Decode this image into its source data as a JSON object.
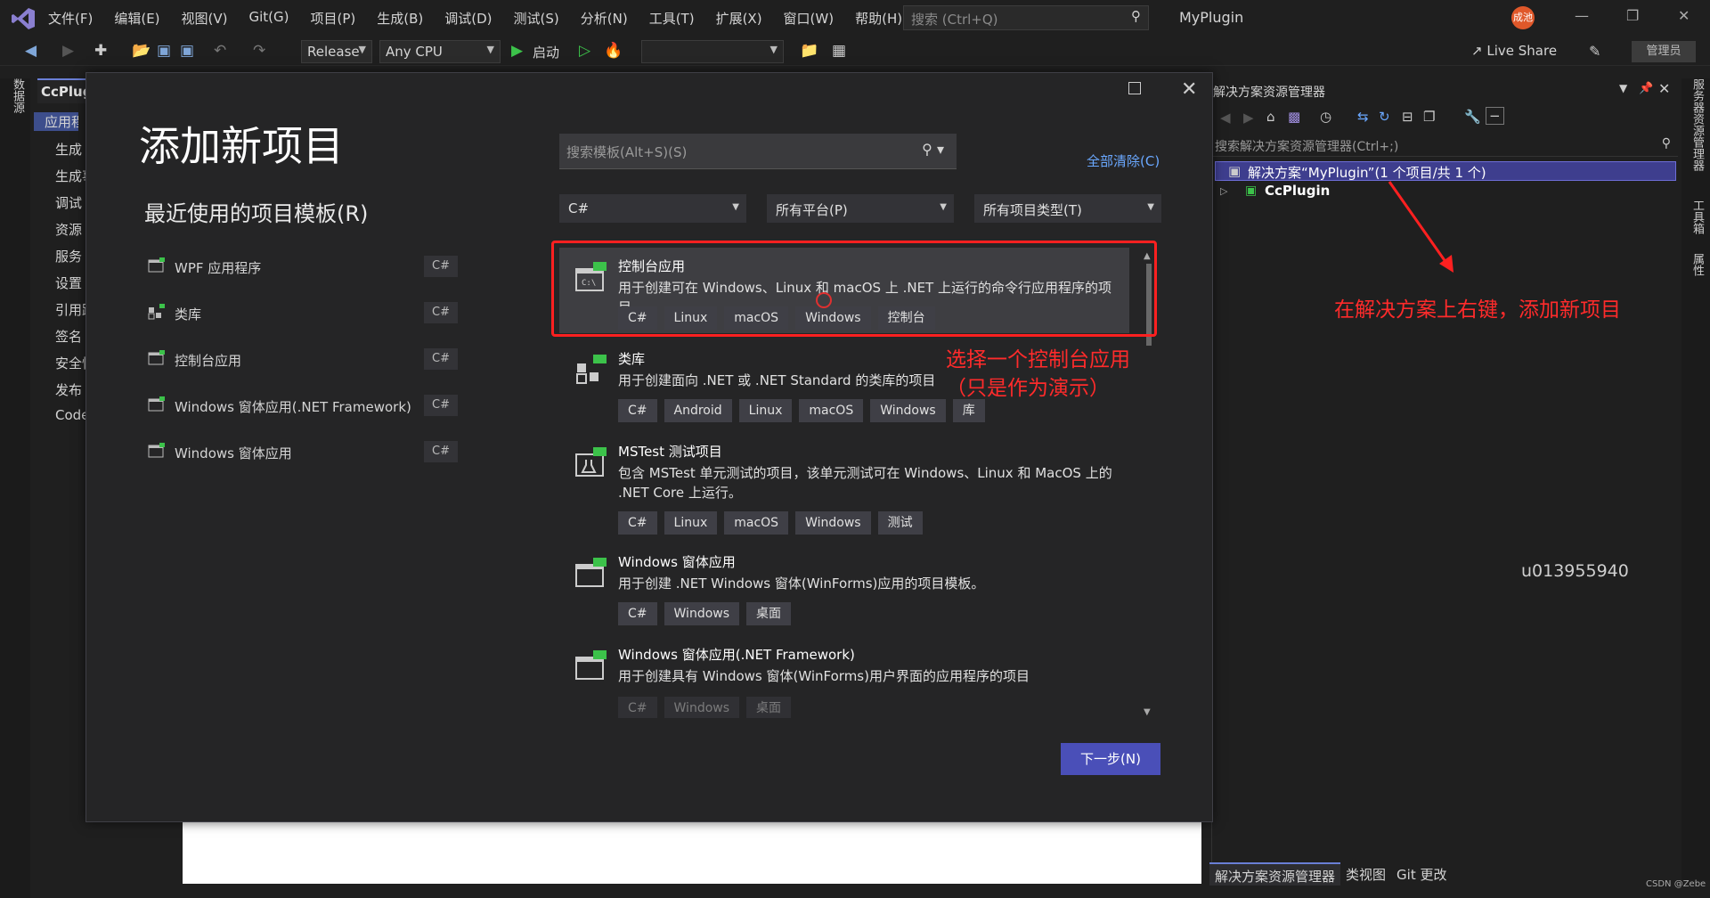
{
  "app": {
    "title": "MyPlugin",
    "menu": [
      "文件(F)",
      "编辑(E)",
      "视图(V)",
      "Git(G)",
      "项目(P)",
      "生成(B)",
      "调试(D)",
      "测试(S)",
      "分析(N)",
      "工具(T)",
      "扩展(X)",
      "窗口(W)",
      "帮助(H)"
    ],
    "search_placeholder": "搜索 (Ctrl+Q)",
    "avatar_text": "成池",
    "live_share": "Live Share",
    "admin_badge": "管理员"
  },
  "toolbar": {
    "configuration": "Release",
    "platform": "Any CPU",
    "start_label": "启动"
  },
  "left_strip": {
    "vertical_tab": "数据源"
  },
  "project_panel": {
    "tab": "CcPlugin",
    "items": [
      "应用程序",
      "生成",
      "生成事件",
      "调试",
      "资源",
      "服务",
      "设置",
      "引用路径",
      "签名",
      "安全性",
      "发布",
      "Code Analysis"
    ]
  },
  "dialog": {
    "title": "添加新项目",
    "recent_title": "最近使用的项目模板(R)",
    "recent": [
      {
        "label": "WPF 应用程序",
        "lang": "C#",
        "icon": "wpf-app-icon"
      },
      {
        "label": "类库",
        "lang": "C#",
        "icon": "class-library-icon"
      },
      {
        "label": "控制台应用",
        "lang": "C#",
        "icon": "console-app-icon"
      },
      {
        "label": "Windows 窗体应用(.NET Framework)",
        "lang": "C#",
        "icon": "winforms-icon"
      },
      {
        "label": "Windows 窗体应用",
        "lang": "C#",
        "icon": "winforms-icon"
      }
    ],
    "search_placeholder": "搜索模板(Alt+S)(S)",
    "clear_all": "全部清除(C)",
    "filters": {
      "language": "C#",
      "platform": "所有平台(P)",
      "project_type": "所有项目类型(T)"
    },
    "templates": [
      {
        "name": "控制台应用",
        "desc": "用于创建可在 Windows、Linux 和 macOS 上 .NET 上运行的命令行应用程序的项目",
        "tags": [
          "C#",
          "Linux",
          "macOS",
          "Windows",
          "控制台"
        ]
      },
      {
        "name": "类库",
        "desc": "用于创建面向 .NET 或 .NET Standard 的类库的项目",
        "tags": [
          "C#",
          "Android",
          "Linux",
          "macOS",
          "Windows",
          "库"
        ]
      },
      {
        "name": "MSTest 测试项目",
        "desc": "包含 MSTest 单元测试的项目，该单元测试可在 Windows、Linux 和 MacOS 上的 .NET Core 上运行。",
        "tags": [
          "C#",
          "Linux",
          "macOS",
          "Windows",
          "测试"
        ]
      },
      {
        "name": "Windows 窗体应用",
        "desc": "用于创建 .NET Windows 窗体(WinForms)应用的项目模板。",
        "tags": [
          "C#",
          "Windows",
          "桌面"
        ]
      },
      {
        "name": "Windows 窗体应用(.NET Framework)",
        "desc": "用于创建具有 Windows 窗体(WinForms)用户界面的应用程序的项目",
        "tags": [
          "C#",
          "Windows",
          "桌面"
        ]
      }
    ],
    "next_button": "下一步(N)"
  },
  "solution_explorer": {
    "title": "解决方案资源管理器",
    "search_placeholder": "搜索解决方案资源管理器(Ctrl+;)",
    "solution_node": "解决方案“MyPlugin”(1 个项目/共 1 个)",
    "project_node": "CcPlugin",
    "tabs": [
      "解决方案资源管理器",
      "类视图",
      "Git 更改"
    ]
  },
  "right_strip": {
    "tabs": [
      "服务器资源管理器",
      "工具箱",
      "属性"
    ]
  },
  "annotations": {
    "right_click_note": "在解决方案上右键，添加新项目",
    "select_note_line1": "选择一个控制台应用",
    "select_note_line2": "（只是作为演示）"
  },
  "watermark": "u013955940",
  "csdn_mark": "CSDN @Zebe",
  "colors": {
    "accent": "#4a4fb8",
    "annotation_red": "#ff2020",
    "selection": "#3e3e8e",
    "link": "#6aa8ff"
  }
}
